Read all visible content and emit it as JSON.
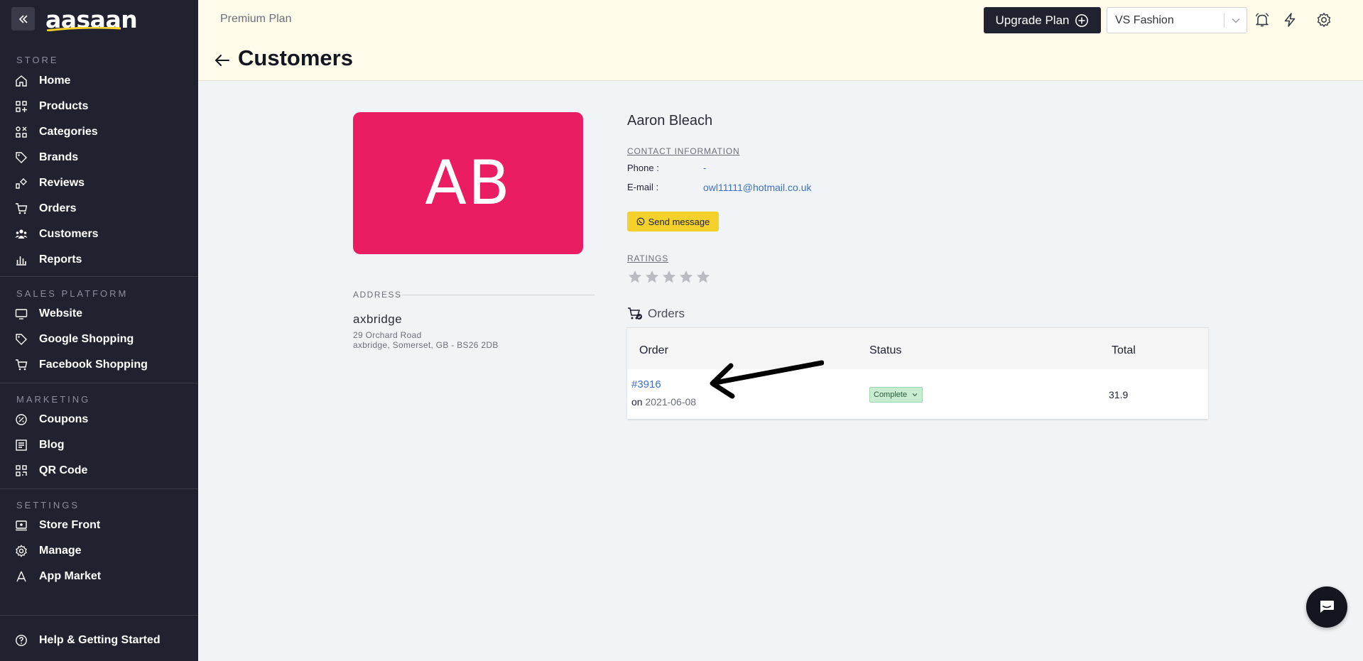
{
  "sidebar": {
    "logo": "aasaan",
    "sections": {
      "store": "STORE",
      "sales": "SALES PLATFORM",
      "marketing": "MARKETING",
      "settings": "SETTINGS"
    },
    "items": {
      "home": {
        "label": "Home",
        "icon": "home-icon"
      },
      "products": {
        "label": "Products",
        "icon": "products-icon"
      },
      "categories": {
        "label": "Categories",
        "icon": "categories-icon"
      },
      "brands": {
        "label": "Brands",
        "icon": "tag-icon"
      },
      "reviews": {
        "label": "Reviews",
        "icon": "reviews-icon"
      },
      "orders": {
        "label": "Orders",
        "icon": "cart-icon"
      },
      "customers": {
        "label": "Customers",
        "icon": "users-icon"
      },
      "reports": {
        "label": "Reports",
        "icon": "bar-chart-icon"
      },
      "website": {
        "label": "Website",
        "icon": "monitor-icon"
      },
      "google": {
        "label": "Google Shopping",
        "icon": "tag-icon"
      },
      "facebook": {
        "label": "Facebook Shopping",
        "icon": "cart-icon"
      },
      "coupons": {
        "label": "Coupons",
        "icon": "coupon-icon"
      },
      "blog": {
        "label": "Blog",
        "icon": "blog-icon"
      },
      "qr": {
        "label": "QR Code",
        "icon": "qr-icon"
      },
      "storefront": {
        "label": "Store Front",
        "icon": "storefront-icon"
      },
      "manage": {
        "label": "Manage",
        "icon": "gear-icon"
      },
      "appmarket": {
        "label": "App Market",
        "icon": "app-market-icon"
      },
      "help": {
        "label": "Help & Getting Started",
        "icon": "help-icon"
      }
    }
  },
  "header": {
    "plan": "Premium Plan",
    "upgrade_label": "Upgrade Plan",
    "store_selected": "VS Fashion",
    "page_title": "Customers"
  },
  "customer": {
    "initials": "AB",
    "name": "Aaron Bleach",
    "contact_label": "CONTACT INFORMATION",
    "phone_key": "Phone :",
    "phone_val": "-",
    "email_key": "E-mail :",
    "email_val": "owl11111@hotmail.co.uk",
    "send_message": "Send message",
    "ratings_label": "RATINGS",
    "rating": 0,
    "rating_max": 5
  },
  "address": {
    "label": "ADDRESS",
    "city": "axbridge",
    "line1": "29 Orchard Road",
    "line2": "axbridge, Somerset, GB - BS26 2DB"
  },
  "orders": {
    "heading": "Orders",
    "columns": {
      "order": "Order",
      "status": "Status",
      "total": "Total"
    },
    "rows": [
      {
        "id": "#3916",
        "on": "on",
        "date": "2021-06-08",
        "status": "Complete",
        "total": "31.9"
      }
    ]
  },
  "colors": {
    "sidebar_bg": "#21222f",
    "header_bg": "#fefbea",
    "avatar_bg": "#ea1c62",
    "link": "#3b6fc9",
    "send_btn": "#f5d12b",
    "status_bg": "#c7ecd2"
  }
}
